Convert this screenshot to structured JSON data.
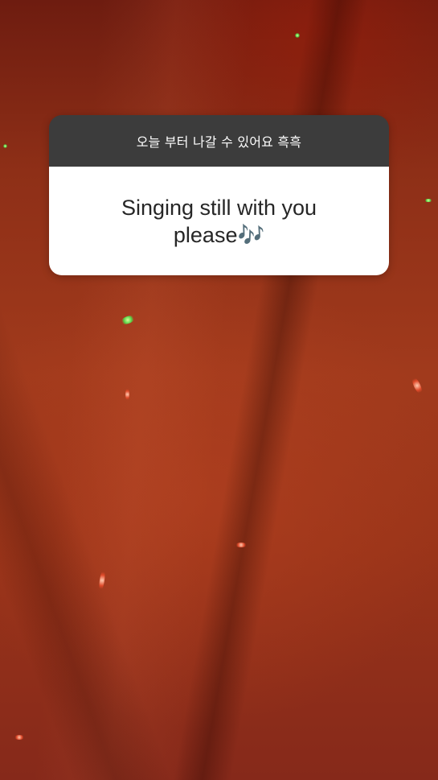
{
  "story": {
    "background": "dark red fabric photo with laser dots",
    "colors": {
      "header_bg": "#3c3c3c",
      "body_bg": "#ffffff",
      "answer_text": "#262626",
      "prompt_text": "#ffffff"
    }
  },
  "question_sticker": {
    "prompt": "오늘 부터 나갈 수 있어요 흑흑",
    "answer": "Singing still with you please🎶"
  }
}
